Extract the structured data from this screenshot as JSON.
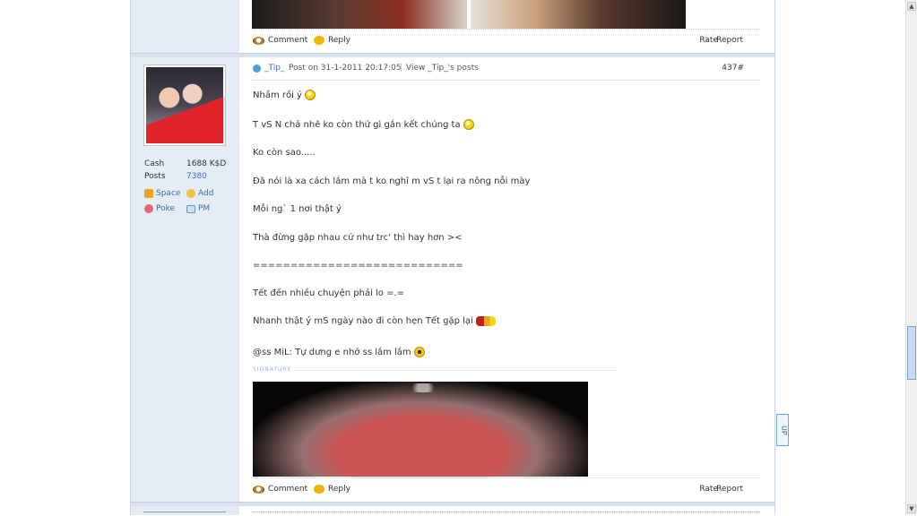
{
  "previous_post": {
    "actions": {
      "comment": "Comment",
      "reply": "Reply",
      "rate": "Rate",
      "report": "Report"
    }
  },
  "post": {
    "author": "_Tip_",
    "posted_on": "Post on 31-1-2011 20:17:05",
    "view_link": "View _Tip_'s posts",
    "floor": "437#",
    "sidebar": {
      "cash_label": "Cash",
      "cash_value": "1688 K$D",
      "posts_label": "Posts",
      "posts_value": "7380",
      "space": "Space",
      "add": "Add",
      "poke": "Poke",
      "pm": "PM"
    },
    "lines": [
      "Nhầm rồi ý",
      "T vS N chả nhẽ ko còn thứ gì gắn kết chúng ta",
      "Ko còn sao.....",
      "Đã nói là xa cách lắm mà t ko nghĩ m  vS t lại ra nông nỗi mày",
      "Mỗi ng` 1 nơi thật ý",
      "Thà đừng gặp nhau cứ như trc' thì hay hơn ><",
      "============================",
      "Tết đến nhiều chuyện phải lo =.=",
      "Nhanh thật ý mS ngày nào đi còn hẹn Tết gặp lại",
      "@ss MiL: Tự dưng e nhớ ss lắm lắm"
    ],
    "signature_label": "SIGNATURE",
    "actions": {
      "comment": "Comment",
      "reply": "Reply",
      "rate": "Rate",
      "report": "Report"
    }
  },
  "up_button": "UP",
  "icons": [
    "comment-icon",
    "reply-icon",
    "online-icon",
    "smiley-icon",
    "car-icon",
    "space-icon",
    "add-friend-icon",
    "poke-icon",
    "pm-icon"
  ]
}
